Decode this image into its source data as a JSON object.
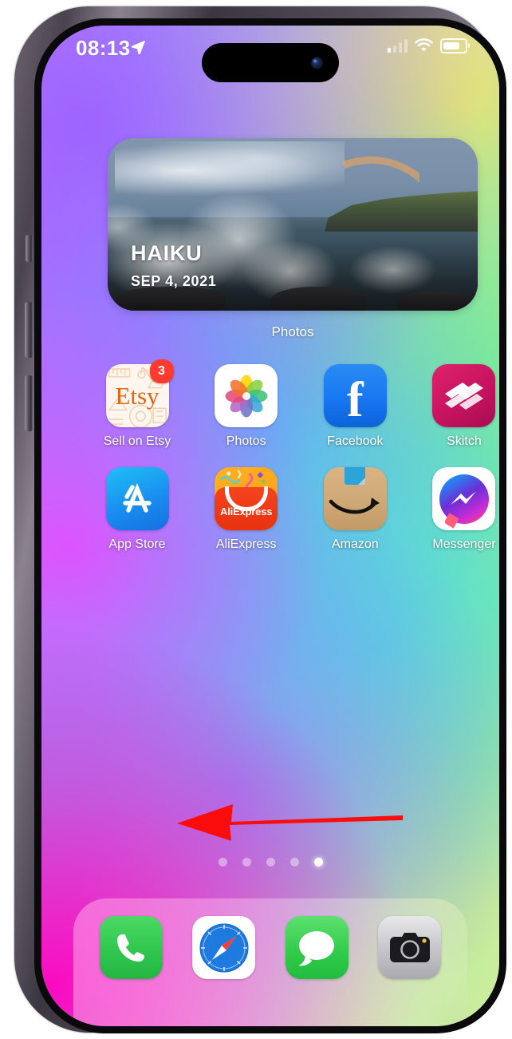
{
  "device": {
    "name": "iPhone 14 Pro",
    "frame_color": "#4a434f"
  },
  "status_bar": {
    "time": "08:13",
    "location_icon": "location-arrow-icon",
    "signal_icon": "cellular-signal-icon",
    "wifi_icon": "wifi-icon",
    "battery_icon": "battery-icon",
    "signal_bars_filled": 1,
    "signal_bars_total": 4
  },
  "dynamic_island": {
    "camera_icon": "front-camera-icon"
  },
  "widget": {
    "app": "Photos",
    "title": "HAIKU",
    "date": "SEP 4, 2021",
    "label": "Photos"
  },
  "home_screen": {
    "rows": [
      [
        {
          "label": "Sell on Etsy",
          "icon": "etsy-icon",
          "badge": "3",
          "brand": "#e8640c"
        },
        {
          "label": "Photos",
          "icon": "photos-icon",
          "badge": "",
          "brand": "#ffffff"
        },
        {
          "label": "Facebook",
          "icon": "facebook-icon",
          "badge": "",
          "brand": "#1877f2"
        },
        {
          "label": "Skitch",
          "icon": "skitch-icon",
          "badge": "",
          "brand": "#e0226b"
        }
      ],
      [
        {
          "label": "App Store",
          "icon": "app-store-icon",
          "badge": "",
          "brand": "#1a8ef0"
        },
        {
          "label": "AliExpress",
          "icon": "aliexpress-icon",
          "badge": "",
          "brand": "#e8320f"
        },
        {
          "label": "Amazon",
          "icon": "amazon-icon",
          "badge": "",
          "brand": "#cfa877"
        },
        {
          "label": "Messenger",
          "icon": "messenger-icon",
          "badge": "",
          "brand": "#c72bd6"
        }
      ]
    ],
    "aliexpress_wordmark": "AliExpress",
    "facebook_letter": "f",
    "etsy_wordmark": "Etsy"
  },
  "page_dots": {
    "total": 5,
    "active_index": 4
  },
  "dock": {
    "items": [
      {
        "label": "Phone",
        "icon": "phone-icon",
        "brand": "#30c74e"
      },
      {
        "label": "Safari",
        "icon": "safari-compass-icon",
        "brand": "#1f7ae0"
      },
      {
        "label": "Messages",
        "icon": "messages-bubble-icon",
        "brand": "#33cc4b"
      },
      {
        "label": "Camera",
        "icon": "camera-icon",
        "brand": "#a9a9ae"
      }
    ]
  },
  "annotation": {
    "type": "arrow",
    "icon": "red-left-arrow-annotation",
    "direction": "left",
    "color": "#fb0d0d",
    "meaning": "Swipe left"
  }
}
